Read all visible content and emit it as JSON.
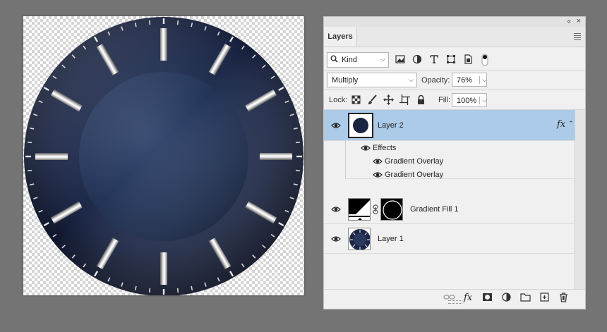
{
  "panel": {
    "tab_label": "Layers",
    "collapse_glyph": "«",
    "close_glyph": "×",
    "filter": {
      "kind_label": "Kind"
    },
    "blend_mode": "Multiply",
    "opacity_label": "Opacity:",
    "opacity_value": "76%",
    "lock_label": "Lock:",
    "fill_label": "Fill:",
    "fill_value": "100%",
    "layers": [
      {
        "name": "Layer 2",
        "selected": true,
        "fx": "fx",
        "effects_label": "Effects",
        "effects": [
          "Gradient Overlay",
          "Gradient Overlay"
        ]
      },
      {
        "name": "Gradient Fill 1",
        "selected": false
      },
      {
        "name": "Layer 1",
        "selected": false
      }
    ]
  },
  "colors": {
    "dial_dark": "#141c33",
    "dial_mid": "#243456",
    "selection": "#abcbe8",
    "panel_bg": "#f0f0f0",
    "workspace": "#747474"
  },
  "icons": {
    "filter": [
      "image-filter-icon",
      "adjustment-filter-icon",
      "type-filter-icon",
      "shape-filter-icon",
      "smart-object-filter-icon",
      "filter-toggle-icon"
    ],
    "lock": [
      "lock-transparent-icon",
      "lock-paint-icon",
      "lock-position-icon",
      "lock-artboard-icon",
      "lock-all-icon"
    ],
    "bottom": [
      "link-layers-icon",
      "add-style-icon",
      "add-mask-icon",
      "new-adjustment-icon",
      "new-group-icon",
      "new-layer-icon",
      "delete-layer-icon"
    ]
  }
}
